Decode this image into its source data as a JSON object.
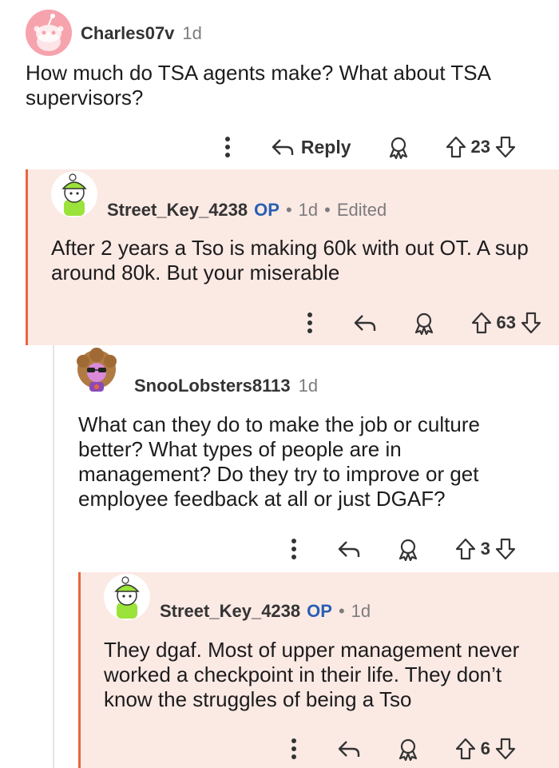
{
  "comments": [
    {
      "username": "Charles07v",
      "time": "1d",
      "text": "How much do TSA agents make? What about TSA supervisors?",
      "reply_label": "Reply",
      "votes": "23"
    },
    {
      "username": "Street_Key_4238",
      "op_badge": "OP",
      "time": "1d",
      "edited": "Edited",
      "text": "After 2 years a Tso is making 60k with out OT. A sup around 80k. But your miserable",
      "votes": "63"
    },
    {
      "username": "SnooLobsters8113",
      "time": "1d",
      "text": "What can they do to make the job or culture better? What types of people are in management? Do they try to improve or get employee feedback at all or just DGAF?",
      "votes": "3"
    },
    {
      "username": "Street_Key_4238",
      "op_badge": "OP",
      "time": "1d",
      "text": "They dgaf. Most of upper management never worked a checkpoint in their life. They don’t know the struggles of being a Tso",
      "votes": "6"
    }
  ],
  "separator": "•",
  "colors": {
    "highlight_bg": "#fbe9e4",
    "op_bar": "#e8663d",
    "op_badge": "#2a5fb3",
    "meta_gray": "#7c7c7c"
  },
  "icons": [
    "more-options-icon",
    "reply-arrow-icon",
    "award-icon",
    "upvote-icon",
    "downvote-icon"
  ]
}
